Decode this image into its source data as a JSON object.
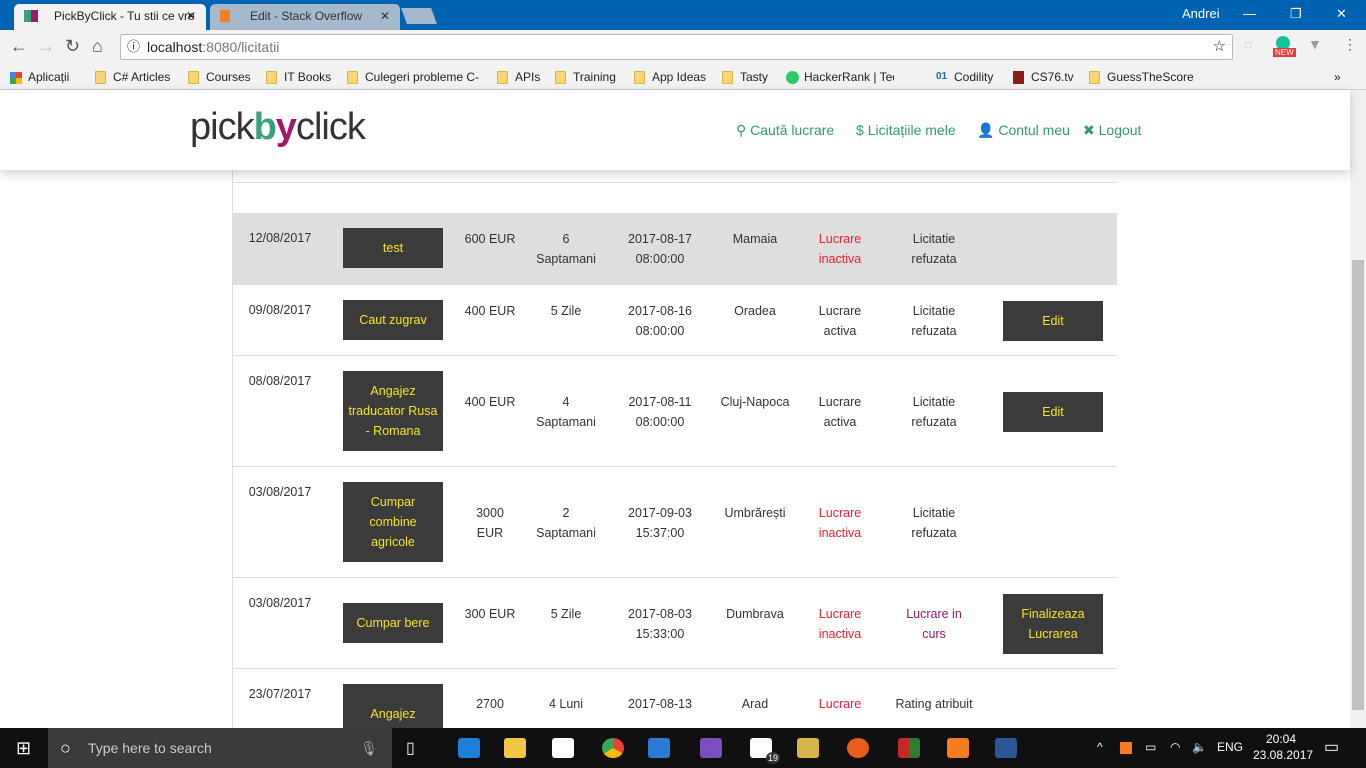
{
  "browser": {
    "tabs": [
      {
        "title": "PickByClick - Tu stii ce vre",
        "close": "✕"
      },
      {
        "title": "Edit - Stack Overflow",
        "close": "✕"
      }
    ],
    "user": "Andrei",
    "url_host": "localhost",
    "url_rest": ":8080/licitatii",
    "bookmarks": [
      "Aplicații",
      "C# Articles",
      "Courses",
      "IT Books",
      "Culegeri probleme C-",
      "APIs",
      "Training",
      "App Ideas",
      "Tasty",
      "HackerRank | Technic",
      "Codility",
      "CS76.tv",
      "GuessTheScore"
    ],
    "badge_new": "NEW"
  },
  "site": {
    "logo": {
      "pick": "pick",
      "b": "b",
      "y": "y",
      "click": "click"
    },
    "menu": [
      {
        "icon": "search-icon",
        "label": "Caută lucrare"
      },
      {
        "icon": "dollar-icon",
        "label": "Licitațiile mele"
      },
      {
        "icon": "user-icon",
        "label": "Contul meu"
      },
      {
        "icon": "close-icon",
        "label": "Logout"
      }
    ]
  },
  "colors": {
    "accent": "#2f9c6f",
    "button_bg": "#3b3b3b",
    "button_text": "#f7e51b",
    "inactive": "#f21d2f"
  },
  "bids": [
    {
      "date": "12/08/2017",
      "title": "test",
      "price": "600 EUR",
      "duration": "6 Saptamani",
      "deadline": "2017-08-17 08:00:00",
      "location": "Mamaia",
      "job_status": "Lucrare inactiva",
      "bid_status": "Licitatie refuzata",
      "action": ""
    },
    {
      "date": "09/08/2017",
      "title": "Caut zugrav",
      "price": "400 EUR",
      "duration": "5 Zile",
      "deadline": "2017-08-16 08:00:00",
      "location": "Oradea",
      "job_status": "Lucrare activa",
      "bid_status": "Licitatie refuzata",
      "action": "Edit"
    },
    {
      "date": "08/08/2017",
      "title": "Angajez traducator Rusa - Romana",
      "price": "400 EUR",
      "duration": "4 Saptamani",
      "deadline": "2017-08-11 08:00:00",
      "location": "Cluj-Napoca",
      "job_status": "Lucrare activa",
      "bid_status": "Licitatie refuzata",
      "action": "Edit"
    },
    {
      "date": "03/08/2017",
      "title": "Cumpar combine agricole",
      "price": "3000 EUR",
      "duration": "2 Saptamani",
      "deadline": "2017-09-03 15:37:00",
      "location": "Umbrărești",
      "job_status": "Lucrare inactiva",
      "bid_status": "Licitatie refuzata",
      "action": ""
    },
    {
      "date": "03/08/2017",
      "title": "Cumpar bere",
      "price": "300 EUR",
      "duration": "5 Zile",
      "deadline": "2017-08-03 15:33:00",
      "location": "Dumbrava",
      "job_status": "Lucrare inactiva",
      "bid_status": "Lucrare in curs",
      "action": "Finalizeaza Lucrarea"
    },
    {
      "date": "23/07/2017",
      "title": "Angajez programator",
      "price": "2700",
      "duration": "4 Luni",
      "deadline": "2017-08-13",
      "location": "Arad",
      "job_status": "Lucrare",
      "bid_status": "Rating atribuit",
      "action": ""
    }
  ],
  "taskbar": {
    "search_placeholder": "Type here to search",
    "lang": "ENG",
    "time": "20:04",
    "date": "23.08.2017",
    "mail_count": "19"
  }
}
